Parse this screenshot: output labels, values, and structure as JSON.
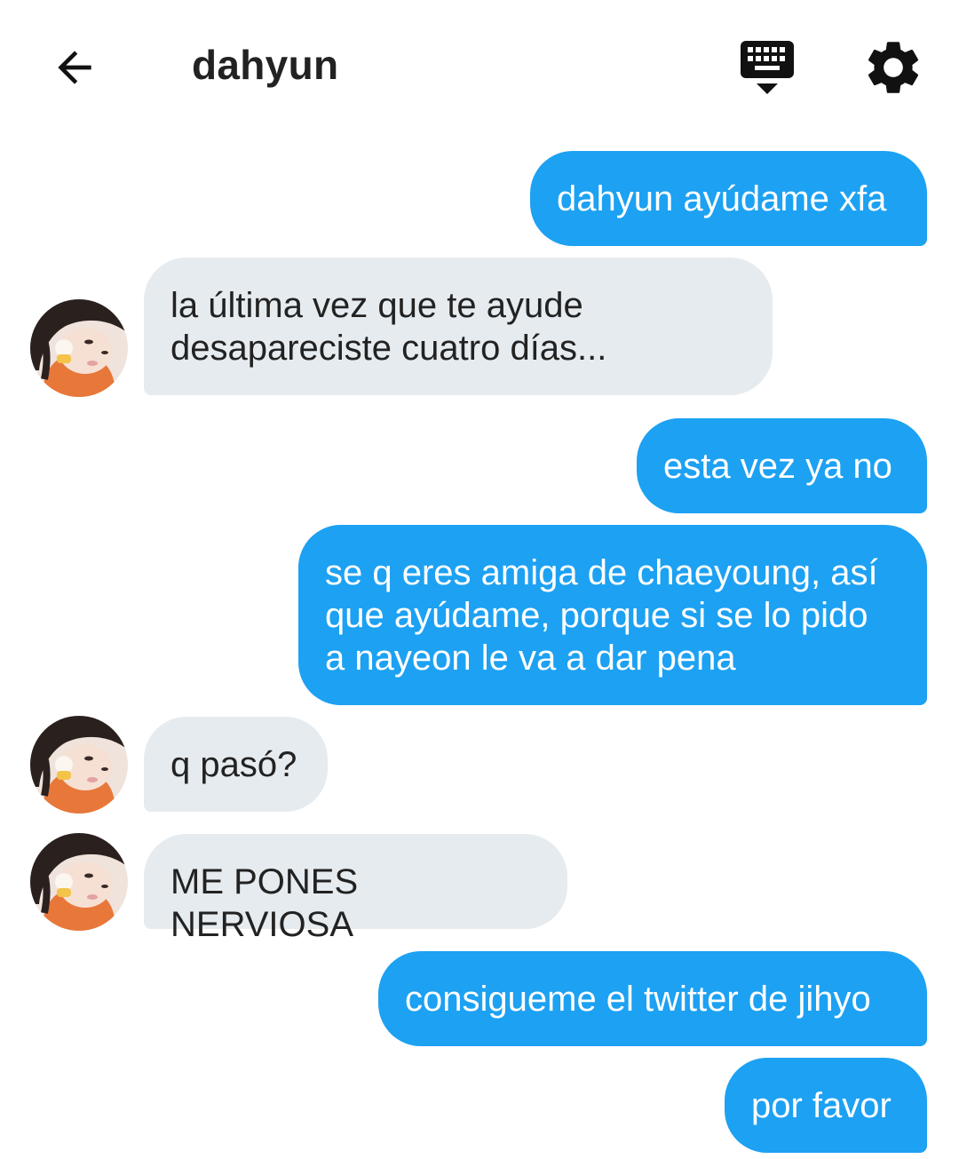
{
  "header": {
    "back_icon": "arrow-left-icon",
    "title": "dahyun",
    "keyboard_icon": "keyboard-hide-icon",
    "settings_icon": "gear-icon"
  },
  "colors": {
    "sent_bubble": "#1da1f2",
    "received_bubble": "#e6ebef",
    "text_dark": "#222222",
    "text_light": "#ffffff"
  },
  "messages": [
    {
      "direction": "sent",
      "text": "dahyun ayúdame xfa"
    },
    {
      "direction": "received",
      "text": "la última vez que te ayude\ndesapareciste cuatro días..."
    },
    {
      "direction": "sent",
      "text": "esta vez ya no"
    },
    {
      "direction": "sent",
      "text": "se q eres amiga de chaeyoung, así\nque ayúdame, porque si se lo pido\na nayeon le va a dar pena"
    },
    {
      "direction": "received",
      "text": "q pasó?"
    },
    {
      "direction": "received",
      "text": "ME PONES NERVIOSA"
    },
    {
      "direction": "sent",
      "text": "consigueme el twitter de jihyo"
    },
    {
      "direction": "sent",
      "text": "por favor"
    }
  ]
}
